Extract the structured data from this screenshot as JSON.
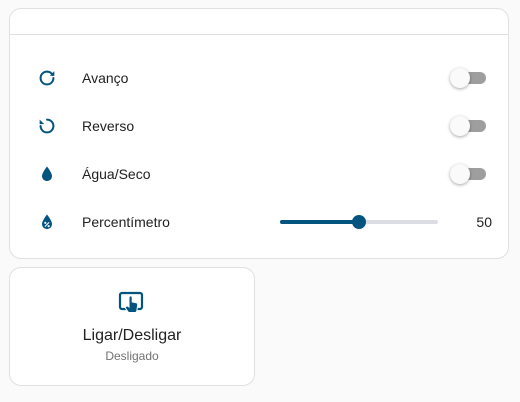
{
  "colors": {
    "accent": "#03557f",
    "icon": "#03557f"
  },
  "controls": [
    {
      "id": "avanco",
      "label": "Avanço",
      "icon": "rotate-right-icon",
      "state": "off"
    },
    {
      "id": "reverso",
      "label": "Reverso",
      "icon": "rotate-left-icon",
      "state": "off"
    },
    {
      "id": "agua-seco",
      "label": "Água/Seco",
      "icon": "water-drop-icon",
      "state": "off"
    }
  ],
  "percentimetro": {
    "label": "Percentímetro",
    "icon": "water-percent-icon",
    "value": 50,
    "display_value": "50",
    "min": 0,
    "max": 100
  },
  "power": {
    "title": "Ligar/Desligar",
    "state_text": "Desligado",
    "icon": "touch-screen-icon"
  }
}
